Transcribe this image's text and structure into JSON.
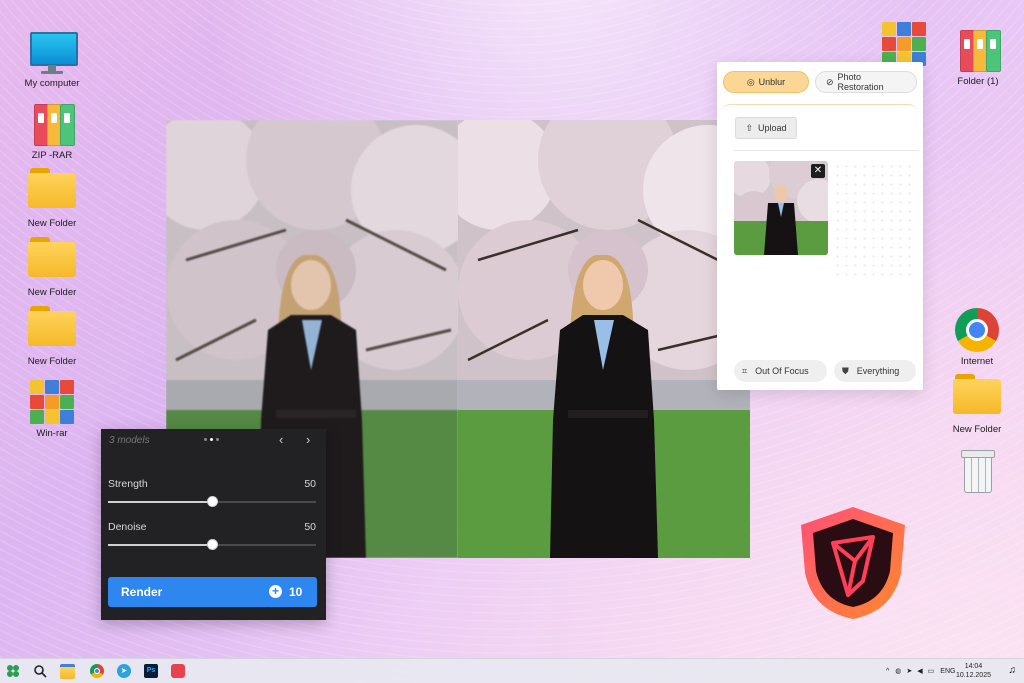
{
  "desktop": {
    "icons_left": [
      {
        "label": "My computer",
        "icon": "computer-icon"
      },
      {
        "label": "ZIP -RAR",
        "icon": "binders-icon"
      },
      {
        "label": "New Folder",
        "icon": "folder-icon"
      },
      {
        "label": "New Folder",
        "icon": "folder-icon"
      },
      {
        "label": "New Folder",
        "icon": "folder-icon"
      },
      {
        "label": "Win-rar",
        "icon": "winrar-icon"
      }
    ],
    "icons_right": [
      {
        "label": "",
        "icon": "winrar-icon"
      },
      {
        "label": "Folder (1)",
        "icon": "binders-icon"
      },
      {
        "label": "Internet",
        "icon": "chrome-icon"
      },
      {
        "label": "New Folder",
        "icon": "folder-icon"
      },
      {
        "label": "",
        "icon": "recycle-bin-icon"
      }
    ]
  },
  "settings_panel": {
    "models_label": "3 models",
    "strength_label": "Strength",
    "strength_value": "50",
    "strength_level": 0.5,
    "denoise_label": "Denoise",
    "denoise_value": "50",
    "denoise_level": 0.5,
    "render_label": "Render",
    "render_cost": "10"
  },
  "unblur_panel": {
    "tab_unblur": "Unblur",
    "tab_photo_restoration": "Photo Restoration",
    "upload_label": "Upload",
    "chip_out_of_focus": "Out Of Focus",
    "chip_everything": "Everything"
  },
  "taskbar": {
    "language": "ENG",
    "time": "14:04",
    "date": "10.12.2025"
  },
  "colors": {
    "accent_blue": "#2e86ef",
    "unblur_pill": "#fbd694",
    "panel_dark": "#222225"
  }
}
